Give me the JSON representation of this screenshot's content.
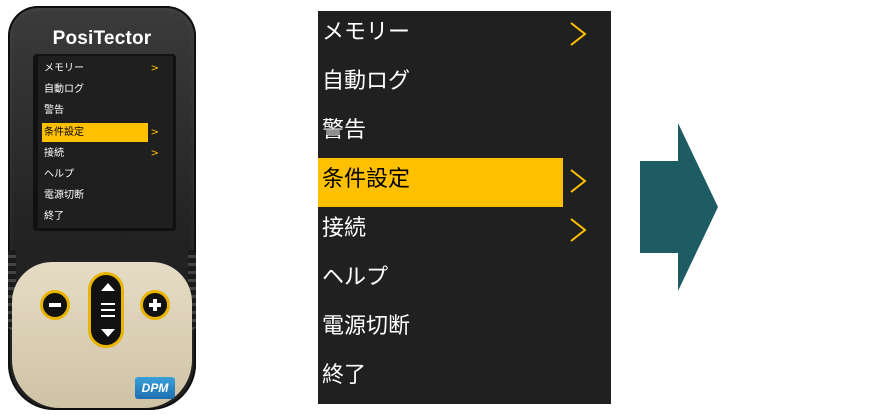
{
  "device": {
    "brand": "PosiTector",
    "model_badge": "DPM",
    "menu": [
      {
        "label": "メモリー",
        "has_submenu": true,
        "selected": false
      },
      {
        "label": "自動ログ",
        "has_submenu": false,
        "selected": false
      },
      {
        "label": "警告",
        "has_submenu": false,
        "selected": false
      },
      {
        "label": "条件設定",
        "has_submenu": true,
        "selected": true
      },
      {
        "label": "接続",
        "has_submenu": true,
        "selected": false
      },
      {
        "label": "ヘルプ",
        "has_submenu": false,
        "selected": false
      },
      {
        "label": "電源切断",
        "has_submenu": false,
        "selected": false
      },
      {
        "label": "終了",
        "has_submenu": false,
        "selected": false
      }
    ],
    "submenu_glyph": ">"
  },
  "zoom_menu": {
    "items": [
      {
        "label": "メモリー",
        "has_submenu": true,
        "selected": false
      },
      {
        "label": "自動ログ",
        "has_submenu": false,
        "selected": false
      },
      {
        "label": "警告",
        "has_submenu": false,
        "selected": false
      },
      {
        "label": "条件設定",
        "has_submenu": true,
        "selected": true
      },
      {
        "label": "接続",
        "has_submenu": true,
        "selected": false
      },
      {
        "label": "ヘルプ",
        "has_submenu": false,
        "selected": false
      },
      {
        "label": "電源切断",
        "has_submenu": false,
        "selected": false
      },
      {
        "label": "終了",
        "has_submenu": false,
        "selected": false
      }
    ]
  },
  "colors": {
    "highlight": "#ffc000",
    "screen_bg": "#202020",
    "arrow": "#1d5c63",
    "button_ring": "#e8b400"
  },
  "icons": {
    "submenu": "chevron-right-icon",
    "next_step": "right-arrow-icon",
    "minus_button": "minus-icon",
    "plus_button": "plus-icon",
    "menu_button": "menu-icon"
  }
}
